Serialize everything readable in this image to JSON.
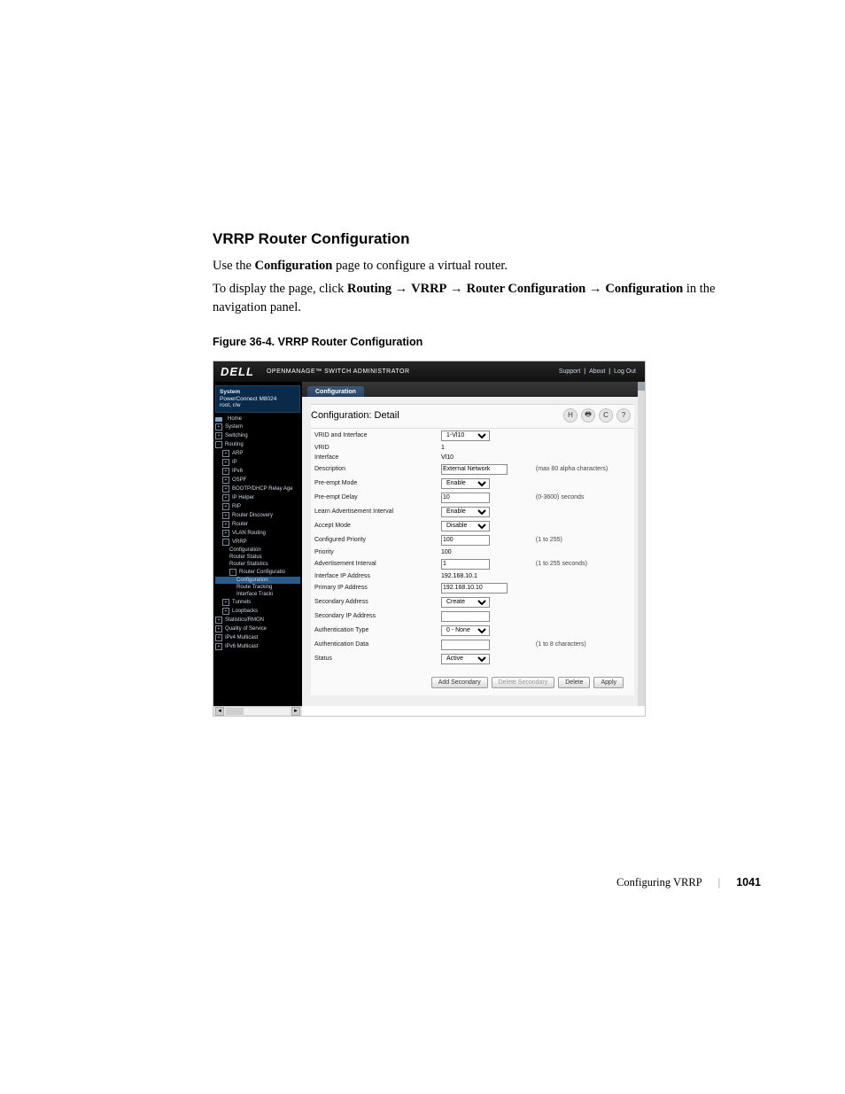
{
  "doc": {
    "section_title": "VRRP Router Configuration",
    "p1_a": "Use the ",
    "p1_b": "Configuration",
    "p1_c": " page to configure a virtual router.",
    "p2_a": "To display the page, click ",
    "p2_b": "Routing",
    "p2_c": "VRRP",
    "p2_d": "Router Configuration",
    "p2_e": "Configuration",
    "p2_f": " in the navigation panel.",
    "figcap": "Figure 36-4.    VRRP Router Configuration"
  },
  "app": {
    "brand": "DELL",
    "brand_sub": "OPENMANAGE™ SWITCH ADMINISTRATOR",
    "top_links": [
      "Support",
      "About",
      "Log Out"
    ],
    "system_box": {
      "title": "System",
      "line2": "PowerConnect M8024",
      "line3": "root, r/w"
    },
    "tab": "Configuration",
    "panel_title": "Configuration: Detail",
    "icons": {
      "save": "H",
      "print": "🖶",
      "refresh": "C",
      "help": "?"
    },
    "buttons": {
      "add_secondary": "Add Secondary",
      "delete_secondary": "Delete Secondary",
      "delete": "Delete",
      "apply": "Apply"
    }
  },
  "nav": [
    {
      "label": "Home",
      "class": "home"
    },
    {
      "label": "System",
      "class": "ind-0",
      "exp": "+"
    },
    {
      "label": "Switching",
      "class": "ind-0",
      "exp": "+"
    },
    {
      "label": "Routing",
      "class": "ind-0",
      "exp": "-"
    },
    {
      "label": "ARP",
      "class": "ind-1",
      "exp": "+"
    },
    {
      "label": "IP",
      "class": "ind-1",
      "exp": "+"
    },
    {
      "label": "IPv6",
      "class": "ind-1",
      "exp": "+"
    },
    {
      "label": "OSPF",
      "class": "ind-1",
      "exp": "+"
    },
    {
      "label": "BOOTP/DHCP Relay Age",
      "class": "ind-1",
      "exp": "+"
    },
    {
      "label": "IP Helper",
      "class": "ind-1",
      "exp": "+"
    },
    {
      "label": "RIP",
      "class": "ind-1",
      "exp": "+"
    },
    {
      "label": "Router Discovery",
      "class": "ind-1",
      "exp": "+"
    },
    {
      "label": "Router",
      "class": "ind-1",
      "exp": "+"
    },
    {
      "label": "VLAN Routing",
      "class": "ind-1",
      "exp": "+"
    },
    {
      "label": "VRRP",
      "class": "ind-1",
      "exp": "-"
    },
    {
      "label": "Configuration",
      "class": "ind-2"
    },
    {
      "label": "Router Status",
      "class": "ind-2"
    },
    {
      "label": "Router Statistics",
      "class": "ind-2"
    },
    {
      "label": "Router Configuratio",
      "class": "ind-2",
      "exp": "-"
    },
    {
      "label": "Configuration",
      "class": "ind-3 nav-hl"
    },
    {
      "label": "Route Tracking",
      "class": "ind-3"
    },
    {
      "label": "Interface Tracki",
      "class": "ind-3"
    },
    {
      "label": "Tunnels",
      "class": "ind-1",
      "exp": "+"
    },
    {
      "label": "Loopbacks",
      "class": "ind-1",
      "exp": "+"
    },
    {
      "label": "Statistics/RMON",
      "class": "ind-0",
      "exp": "+"
    },
    {
      "label": "Quality of Service",
      "class": "ind-0",
      "exp": "+"
    },
    {
      "label": "IPv4 Multicast",
      "class": "ind-0",
      "exp": "+"
    },
    {
      "label": "IPv6 Multicast",
      "class": "ind-0",
      "exp": "+"
    }
  ],
  "fields": [
    {
      "lbl": "VRID and Interface",
      "ctl": "select",
      "val": "1-Vl10"
    },
    {
      "lbl": "VRID",
      "ctl": "text",
      "val": "1"
    },
    {
      "lbl": "Interface",
      "ctl": "text",
      "val": "Vl10"
    },
    {
      "lbl": "Description",
      "ctl": "input",
      "val": "External Network",
      "hint": "(max 80 alpha characters)"
    },
    {
      "lbl": "Pre-empt Mode",
      "ctl": "select",
      "val": "Enable"
    },
    {
      "lbl": "Pre-empt Delay",
      "ctl": "input",
      "val": "10",
      "hint": "(0-3600) seconds"
    },
    {
      "lbl": "Learn Advertisement Interval",
      "ctl": "select",
      "val": "Enable"
    },
    {
      "lbl": "Accept Mode",
      "ctl": "select",
      "val": "Disable"
    },
    {
      "lbl": "Configured Priority",
      "ctl": "input",
      "val": "100",
      "hint": "(1 to 255)"
    },
    {
      "lbl": "Priority",
      "ctl": "text",
      "val": "100"
    },
    {
      "lbl": "Advertisement Interval",
      "ctl": "input",
      "val": "1",
      "hint": "(1 to 255 seconds)"
    },
    {
      "lbl": "Interface IP Address",
      "ctl": "text",
      "val": "192.168.10.1"
    },
    {
      "lbl": "Primary IP Address",
      "ctl": "input",
      "val": "192.168.10.10"
    },
    {
      "lbl": "Secondary Address",
      "ctl": "select",
      "val": "Create"
    },
    {
      "lbl": "Secondary IP Address",
      "ctl": "input",
      "val": ""
    },
    {
      "lbl": "Authentication Type",
      "ctl": "select",
      "val": "0 - None"
    },
    {
      "lbl": "Authentication Data",
      "ctl": "input",
      "val": "",
      "hint": "(1 to 8 characters)"
    },
    {
      "lbl": "Status",
      "ctl": "select",
      "val": "Active"
    }
  ],
  "footer": {
    "chapter": "Configuring VRRP",
    "pnum": "1041"
  }
}
